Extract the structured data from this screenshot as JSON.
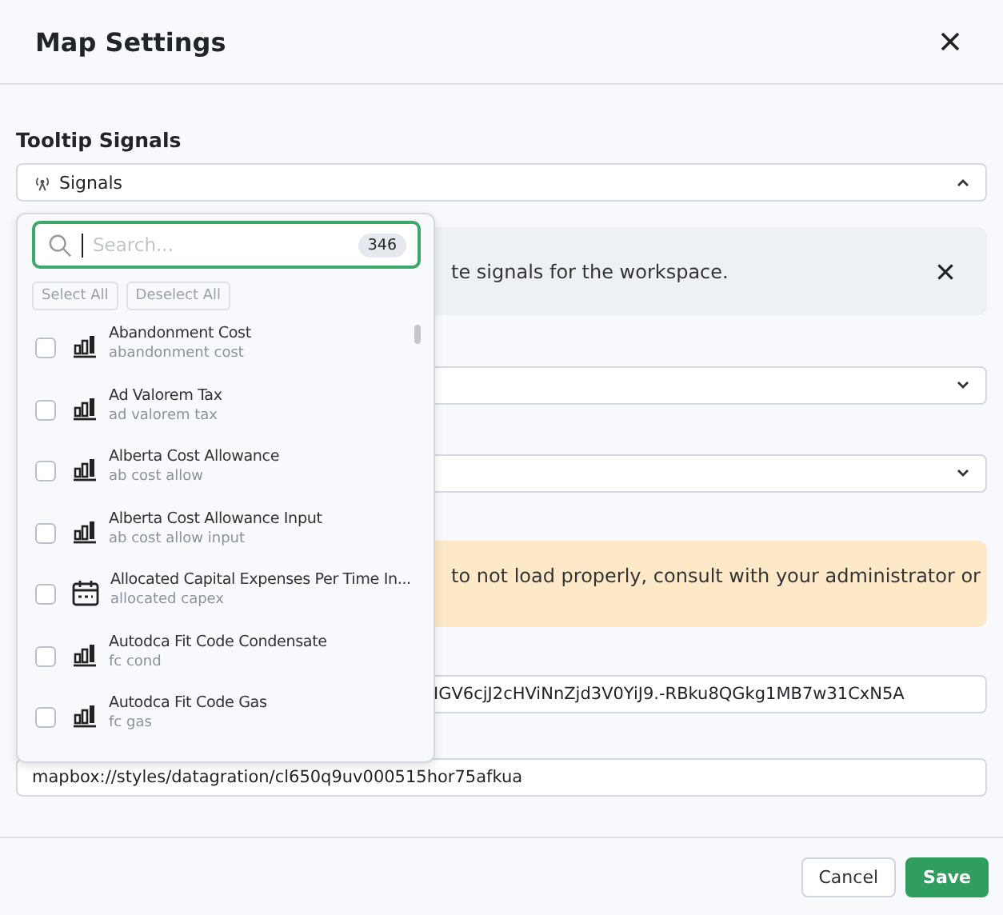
{
  "dialog": {
    "title": "Map Settings"
  },
  "tooltip_signals": {
    "label": "Tooltip Signals",
    "select": {
      "value": "Signals",
      "expanded": true
    }
  },
  "signals_dropdown": {
    "search": {
      "placeholder": "Search...",
      "count": "346"
    },
    "select_all": "Select All",
    "deselect_all": "Deselect All",
    "items": [
      {
        "title": "Abandonment Cost",
        "subtitle": "abandonment cost",
        "kind": "chart",
        "checked": false
      },
      {
        "title": "Ad Valorem Tax",
        "subtitle": "ad valorem tax",
        "kind": "chart",
        "checked": false
      },
      {
        "title": "Alberta Cost Allowance",
        "subtitle": "ab cost allow",
        "kind": "chart",
        "checked": false
      },
      {
        "title": "Alberta Cost Allowance Input",
        "subtitle": "ab cost allow input",
        "kind": "chart",
        "checked": false
      },
      {
        "title": "Allocated Capital Expenses Per Time In...",
        "subtitle": "allocated capex",
        "kind": "calendar",
        "checked": false
      },
      {
        "title": "Autodca Fit Code Condensate",
        "subtitle": "fc cond",
        "kind": "chart",
        "checked": false
      },
      {
        "title": "Autodca Fit Code Gas",
        "subtitle": "fc gas",
        "kind": "chart",
        "checked": false
      }
    ]
  },
  "info_alert": {
    "text": "te signals for the workspace."
  },
  "warning_alert": {
    "text": "to not load properly, consult with your administrator or"
  },
  "token_field": {
    "value": "IGV6cjJ2cHViNnZjd3V0YiJ9.-RBku8QGkg1MB7w31CxN5A"
  },
  "style_field": {
    "value": "mapbox://styles/datagration/cl650q9uv000515hor75afkua"
  },
  "buttons": {
    "cancel": "Cancel",
    "save": "Save"
  }
}
